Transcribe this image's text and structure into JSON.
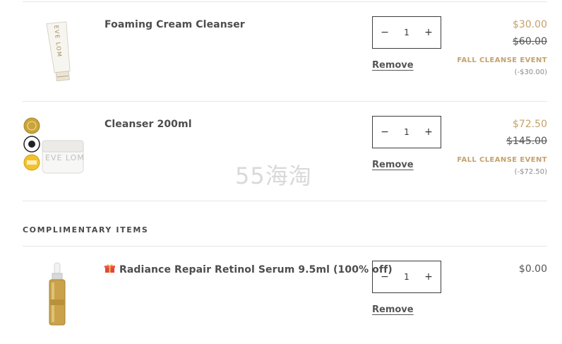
{
  "cart": {
    "items": [
      {
        "name": "Foaming Cream Cleanser",
        "quantity": "1",
        "remove_label": "Remove",
        "sale_price": "$30.00",
        "original_price": "$60.00",
        "event_label": "FALL CLEANSE EVENT",
        "discount": "(-$30.00)",
        "tube_brand": "EVE LOM"
      },
      {
        "name": "Cleanser 200ml",
        "quantity": "1",
        "remove_label": "Remove",
        "sale_price": "$72.50",
        "original_price": "$145.00",
        "event_label": "FALL CLEANSE EVENT",
        "discount": "(-$72.50)",
        "jar_brand": "EVE LOM"
      }
    ],
    "complimentary": {
      "title": "COMPLIMENTARY ITEMS",
      "items": [
        {
          "icon": "gift-icon",
          "name": "Radiance Repair Retinol Serum 9.5ml (100% off)",
          "quantity": "1",
          "remove_label": "Remove",
          "price": "$0.00"
        }
      ]
    },
    "qty_controls": {
      "minus": "−",
      "plus": "+"
    }
  },
  "watermark": "55海淘",
  "colors": {
    "accent_gold": "#c4a16b",
    "text": "#4d4d4d",
    "divider": "#e8e6e3"
  }
}
